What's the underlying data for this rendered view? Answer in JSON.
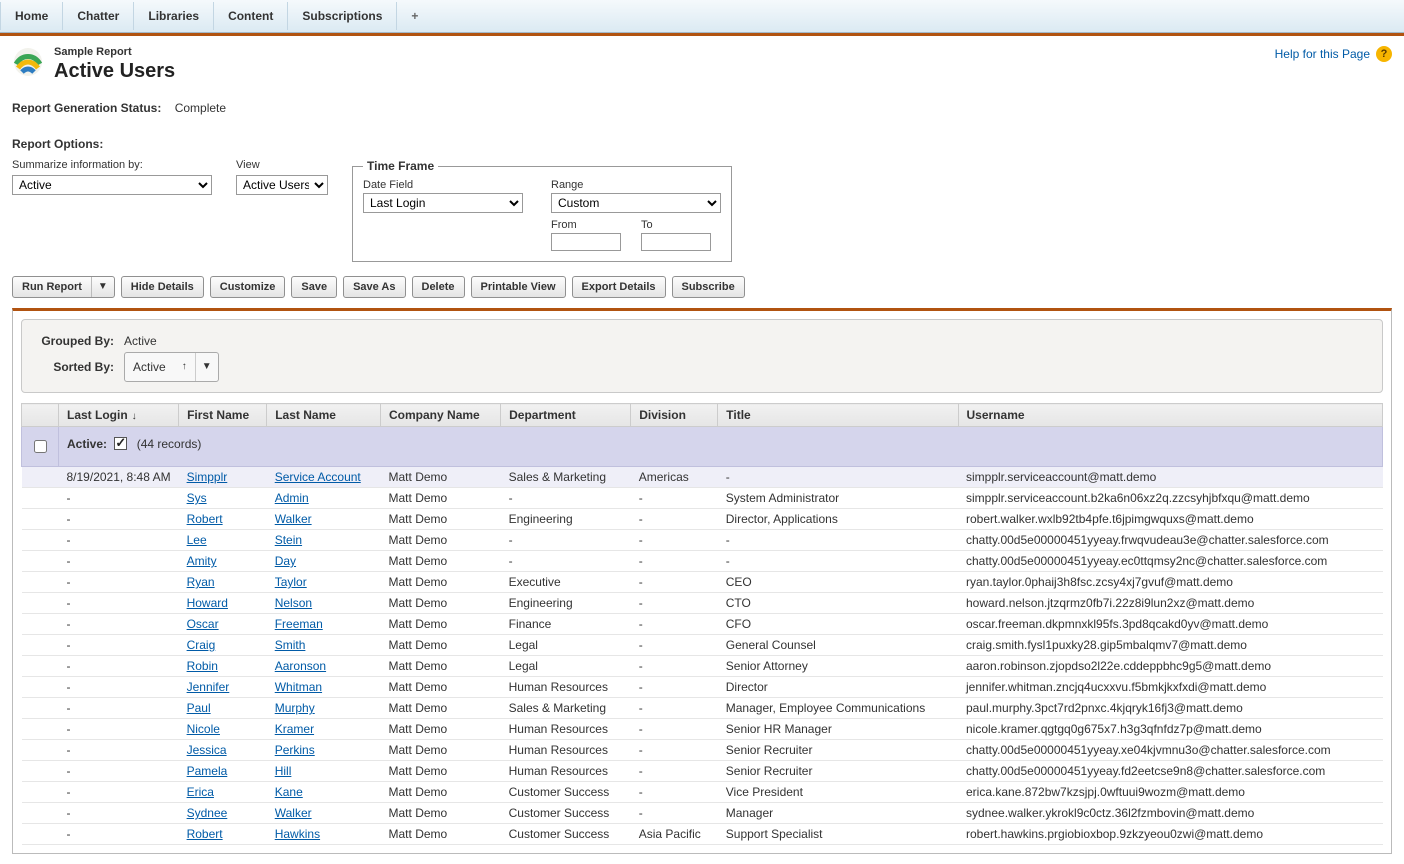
{
  "tabs": [
    "Home",
    "Chatter",
    "Libraries",
    "Content",
    "Subscriptions"
  ],
  "addTabGlyph": "+",
  "header": {
    "overline": "Sample Report",
    "title": "Active Users",
    "helpLabel": "Help for this Page"
  },
  "status": {
    "label": "Report Generation Status:",
    "value": "Complete"
  },
  "optionsTitle": "Report Options:",
  "options": {
    "summarizeLabel": "Summarize information by:",
    "summarizeValue": "Active",
    "viewLabel": "View",
    "viewValue": "Active Users",
    "timeFrame": {
      "legend": "Time Frame",
      "dateFieldLabel": "Date Field",
      "dateFieldValue": "Last Login",
      "rangeLabel": "Range",
      "rangeValue": "Custom",
      "fromLabel": "From",
      "fromValue": "",
      "toLabel": "To",
      "toValue": ""
    }
  },
  "toolbar": {
    "runReport": "Run Report",
    "hideDetails": "Hide Details",
    "customize": "Customize",
    "save": "Save",
    "saveAs": "Save As",
    "delete": "Delete",
    "printable": "Printable View",
    "exportDetails": "Export Details",
    "subscribe": "Subscribe"
  },
  "grouping": {
    "groupedByLabel": "Grouped By:",
    "groupedByValue": "Active",
    "sortedByLabel": "Sorted By:",
    "sortedByValue": "Active",
    "sortDirGlyph": "↑"
  },
  "columns": [
    "Last Login",
    "First Name",
    "Last Name",
    "Company Name",
    "Department",
    "Division",
    "Title",
    "Username"
  ],
  "sortColGlyph": "↓",
  "groupRow": {
    "prefix": "Active:",
    "countText": "(44 records)"
  },
  "rows": [
    {
      "login": "8/19/2021, 8:48 AM",
      "first": "Simpplr",
      "last": "Service Account",
      "company": "Matt Demo",
      "dept": "Sales & Marketing",
      "div": "Americas",
      "title": "-",
      "user": "simpplr.serviceaccount@matt.demo",
      "hl": true
    },
    {
      "login": "-",
      "first": "Sys",
      "last": "Admin",
      "company": "Matt Demo",
      "dept": "-",
      "div": "-",
      "title": "System Administrator",
      "user": "simpplr.serviceaccount.b2ka6n06xz2q.zzcsyhjbfxqu@matt.demo"
    },
    {
      "login": "-",
      "first": "Robert",
      "last": "Walker",
      "company": "Matt Demo",
      "dept": "Engineering",
      "div": "-",
      "title": "Director, Applications",
      "user": "robert.walker.wxlb92tb4pfe.t6jpimgwquxs@matt.demo"
    },
    {
      "login": "-",
      "first": "Lee",
      "last": "Stein",
      "company": "Matt Demo",
      "dept": "-",
      "div": "-",
      "title": "-",
      "user": "chatty.00d5e00000451yyeay.frwqvudeau3e@chatter.salesforce.com"
    },
    {
      "login": "-",
      "first": "Amity",
      "last": "Day",
      "company": "Matt Demo",
      "dept": "-",
      "div": "-",
      "title": "-",
      "user": "chatty.00d5e00000451yyeay.ec0ttqmsy2nc@chatter.salesforce.com"
    },
    {
      "login": "-",
      "first": "Ryan",
      "last": "Taylor",
      "company": "Matt Demo",
      "dept": "Executive",
      "div": "-",
      "title": "CEO",
      "user": "ryan.taylor.0phaij3h8fsc.zcsy4xj7gvuf@matt.demo"
    },
    {
      "login": "-",
      "first": "Howard",
      "last": "Nelson",
      "company": "Matt Demo",
      "dept": "Engineering",
      "div": "-",
      "title": "CTO",
      "user": "howard.nelson.jtzqrmz0fb7i.22z8i9lun2xz@matt.demo"
    },
    {
      "login": "-",
      "first": "Oscar",
      "last": "Freeman",
      "company": "Matt Demo",
      "dept": "Finance",
      "div": "-",
      "title": "CFO",
      "user": "oscar.freeman.dkpmnxkl95fs.3pd8qcakd0yv@matt.demo"
    },
    {
      "login": "-",
      "first": "Craig",
      "last": "Smith",
      "company": "Matt Demo",
      "dept": "Legal",
      "div": "-",
      "title": "General Counsel",
      "user": "craig.smith.fysl1puxky28.gip5mbalqmv7@matt.demo"
    },
    {
      "login": "-",
      "first": "Robin",
      "last": "Aaronson",
      "company": "Matt Demo",
      "dept": "Legal",
      "div": "-",
      "title": "Senior Attorney",
      "user": "aaron.robinson.zjopdso2l22e.cddeppbhc9g5@matt.demo"
    },
    {
      "login": "-",
      "first": "Jennifer",
      "last": "Whitman",
      "company": "Matt Demo",
      "dept": "Human Resources",
      "div": "-",
      "title": "Director",
      "user": "jennifer.whitman.zncjq4ucxxvu.f5bmkjkxfxdi@matt.demo"
    },
    {
      "login": "-",
      "first": "Paul",
      "last": "Murphy",
      "company": "Matt Demo",
      "dept": "Sales & Marketing",
      "div": "-",
      "title": "Manager, Employee Communications",
      "user": "paul.murphy.3pct7rd2pnxc.4kjqryk16fj3@matt.demo"
    },
    {
      "login": "-",
      "first": "Nicole",
      "last": "Kramer",
      "company": "Matt Demo",
      "dept": "Human Resources",
      "div": "-",
      "title": "Senior HR Manager",
      "user": "nicole.kramer.qgtgq0g675x7.h3g3qfnfdz7p@matt.demo"
    },
    {
      "login": "-",
      "first": "Jessica",
      "last": "Perkins",
      "company": "Matt Demo",
      "dept": "Human Resources",
      "div": "-",
      "title": "Senior Recruiter",
      "user": "chatty.00d5e00000451yyeay.xe04kjvmnu3o@chatter.salesforce.com"
    },
    {
      "login": "-",
      "first": "Pamela",
      "last": "Hill",
      "company": "Matt Demo",
      "dept": "Human Resources",
      "div": "-",
      "title": "Senior Recruiter",
      "user": "chatty.00d5e00000451yyeay.fd2eetcse9n8@chatter.salesforce.com"
    },
    {
      "login": "-",
      "first": "Erica",
      "last": "Kane",
      "company": "Matt Demo",
      "dept": "Customer Success",
      "div": "-",
      "title": "Vice President",
      "user": "erica.kane.872bw7kzsjpj.0wftuui9wozm@matt.demo"
    },
    {
      "login": "-",
      "first": "Sydnee",
      "last": "Walker",
      "company": "Matt Demo",
      "dept": "Customer Success",
      "div": "-",
      "title": "Manager",
      "user": "sydnee.walker.ykrokl9c0ctz.36l2fzmbovin@matt.demo"
    },
    {
      "login": "-",
      "first": "Robert",
      "last": "Hawkins",
      "company": "Matt Demo",
      "dept": "Customer Success",
      "div": "Asia Pacific",
      "title": "Support Specialist",
      "user": "robert.hawkins.prgiobioxbop.9zkzyeou0zwi@matt.demo"
    }
  ]
}
